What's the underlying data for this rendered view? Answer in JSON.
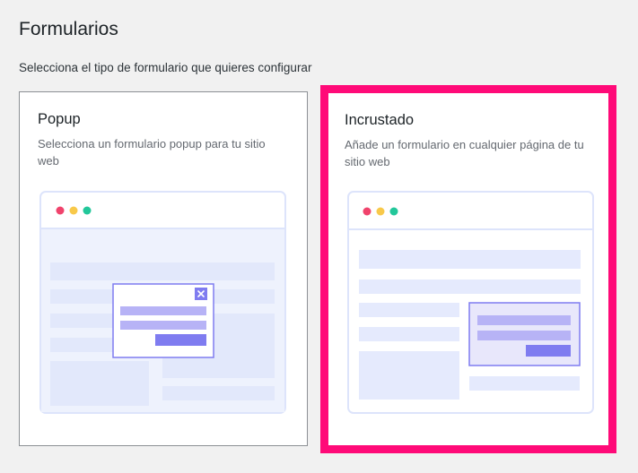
{
  "page": {
    "title": "Formularios",
    "subtitle": "Selecciona el tipo de formulario que quieres configurar"
  },
  "cards": {
    "popup": {
      "title": "Popup",
      "description": "Selecciona un formulario popup para tu sitio web",
      "selected": false,
      "illustration_icons": [
        "window-dots-icon",
        "close-x-icon"
      ]
    },
    "embed": {
      "title": "Incrustado",
      "description": "Añade un formulario en cualquier página de tu sitio web",
      "selected": true,
      "illustration_icons": [
        "window-dots-icon"
      ]
    }
  },
  "colors": {
    "selection_border": "#ff0a78",
    "card_border": "#8c8f94",
    "window_dot_red": "#f0436c",
    "window_dot_yellow": "#f8c94a",
    "window_dot_green": "#22c79a",
    "accent_purple": "#7f7cf0",
    "light_purple": "#b7b3f6",
    "skeleton_blue": "#e5eafd"
  }
}
